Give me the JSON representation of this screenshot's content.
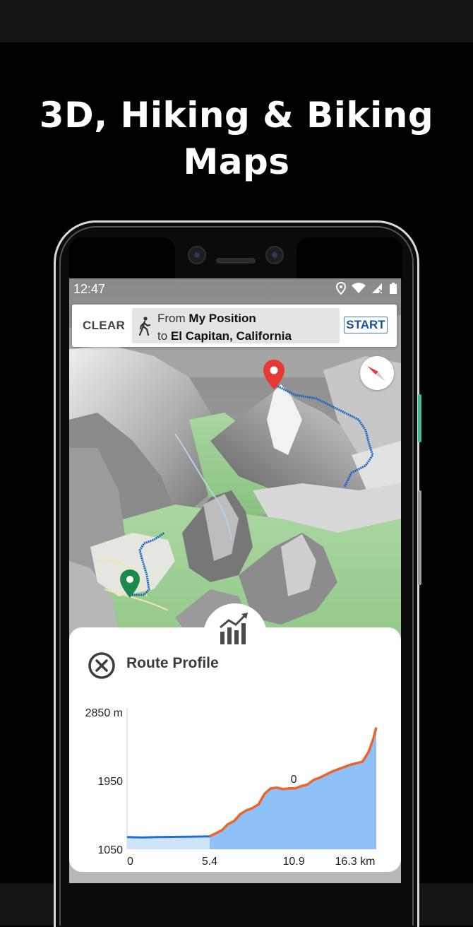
{
  "promo": {
    "title_line1": "3D, Hiking & Biking",
    "title_line2": "Maps"
  },
  "status_bar": {
    "time": "12:47",
    "icons": [
      "location-icon",
      "wifi-icon",
      "signal-icon",
      "battery-icon"
    ]
  },
  "route_bar": {
    "clear_label": "CLEAR",
    "from_prefix": "From",
    "from_value": "My Position",
    "to_prefix": "to",
    "to_value": "El Capitan, California",
    "start_label": "START",
    "mode_icon": "walk-icon"
  },
  "map": {
    "destination_marker_color": "#e53935",
    "origin_marker_color": "#1b8a4c",
    "route_color": "#1565c0"
  },
  "route_profile": {
    "title": "Route Profile",
    "close_icon": "close-circle-icon",
    "panel_icon": "chart-trend-icon",
    "chart_data": {
      "type": "area",
      "y_ticks": [
        "2850 m",
        "1950",
        "1050"
      ],
      "x_ticks": [
        "0",
        "5.4",
        "10.9",
        "16.3 km"
      ],
      "ylim": [
        1050,
        2850
      ],
      "xlim": [
        0,
        16.3
      ],
      "cursor_label": "0",
      "cursor_x": 10.9,
      "x": [
        0,
        1,
        2,
        3,
        4,
        5,
        5.4,
        5.8,
        6.2,
        6.6,
        7,
        7.4,
        7.8,
        8.2,
        8.6,
        9,
        9.4,
        9.8,
        10.2,
        10.6,
        11,
        11.4,
        11.8,
        12.2,
        12.6,
        13,
        13.4,
        13.8,
        14.2,
        14.6,
        15,
        15.4,
        15.8,
        16.1,
        16.3
      ],
      "y": [
        1210,
        1205,
        1210,
        1212,
        1215,
        1218,
        1220,
        1260,
        1300,
        1380,
        1420,
        1510,
        1560,
        1590,
        1640,
        1780,
        1850,
        1860,
        1840,
        1850,
        1850,
        1880,
        1900,
        1960,
        1990,
        2030,
        2070,
        2100,
        2130,
        2160,
        2180,
        2200,
        2330,
        2500,
        2650
      ],
      "colors": {
        "done_fill": "#cfe4fa",
        "done_line": "#1f6fd1",
        "remaining_fill": "#8ec1f7",
        "remaining_line": "#f0622c"
      }
    }
  }
}
